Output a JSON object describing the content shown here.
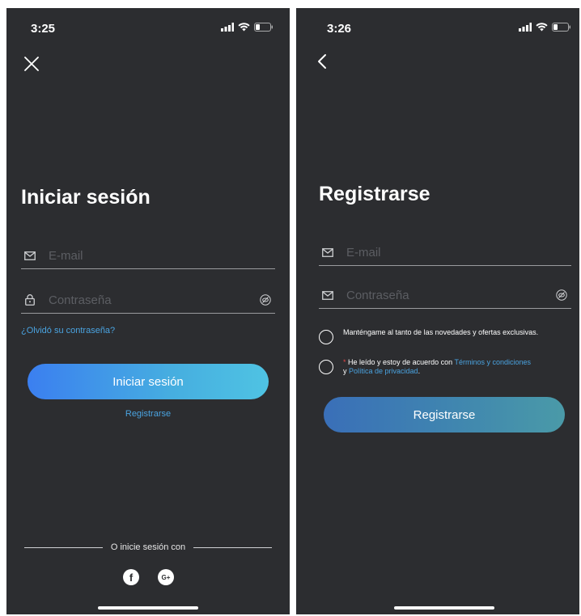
{
  "login": {
    "status_time": "3:25",
    "title": "Iniciar sesión",
    "email_placeholder": "E-mail",
    "password_placeholder": "Contraseña",
    "forgot_password": "¿Olvidó su contraseña?",
    "login_button": "Iniciar sesión",
    "register_link": "Registrarse",
    "divider_text": "O inicie sesión con",
    "social": {
      "facebook_glyph": "f",
      "google_glyph": "G+"
    }
  },
  "register": {
    "status_time": "3:26",
    "title": "Registrarse",
    "email_placeholder": "E-mail",
    "password_placeholder": "Contraseña",
    "newsletter_text": "Manténgame al tanto de las novedades y ofertas exclusivas.",
    "terms": {
      "required_mark": "*",
      "prefix": "He leído y estoy de acuerdo con",
      "terms_link": "Términos y condiciones",
      "joiner": "y",
      "privacy_link": "Política de privacidad",
      "suffix": "."
    },
    "register_button": "Registrarse"
  },
  "colors": {
    "background": "#2c2d30",
    "link": "#4aa3e0",
    "divider": "#9a9b9e",
    "placeholder": "#5c5e63",
    "required": "#e64545"
  }
}
